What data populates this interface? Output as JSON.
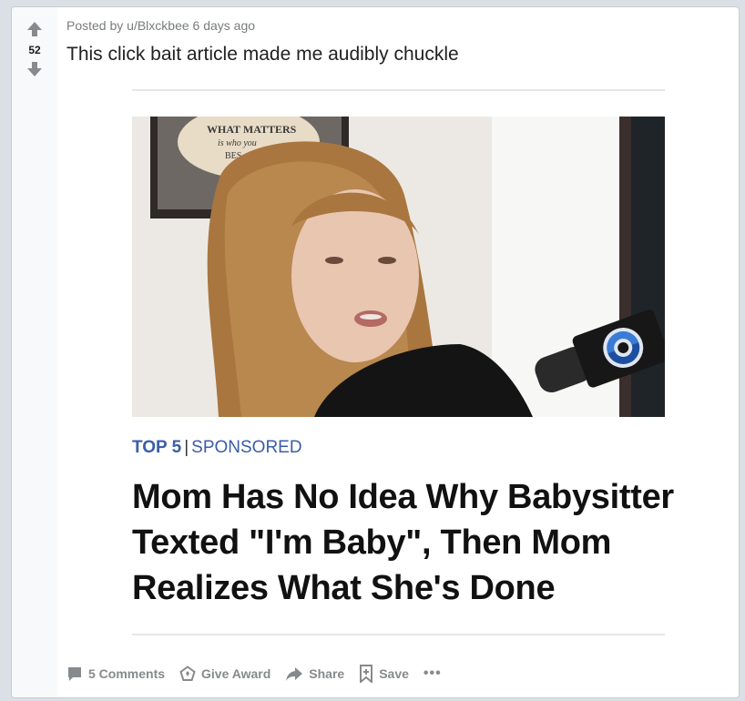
{
  "post": {
    "score": "52",
    "posted_by_prefix": "Posted by",
    "author": "u/Blxckbee",
    "age": "6 days ago",
    "title": "This click bait article made me audibly chuckle"
  },
  "article": {
    "tag_top": "TOP 5",
    "tag_sep": "|",
    "tag_sponsored": "SPONSORED",
    "headline": "Mom Has No Idea Why Babysitter Texted \"I'm Baby\", Then Mom Realizes What She's Done",
    "sign_text": "WHAT MATTERS",
    "sign_sub": "is who you",
    "sign_sub2": "BES"
  },
  "actions": {
    "comments": "5 Comments",
    "award": "Give Award",
    "share": "Share",
    "save": "Save",
    "more": "•••"
  },
  "colors": {
    "accent": "#3a5da8",
    "muted": "#878a8c",
    "vote_bg": "#f8f9fa"
  },
  "icons": [
    "upvote-icon",
    "downvote-icon",
    "comment-icon",
    "award-icon",
    "share-icon",
    "save-icon",
    "more-icon"
  ]
}
